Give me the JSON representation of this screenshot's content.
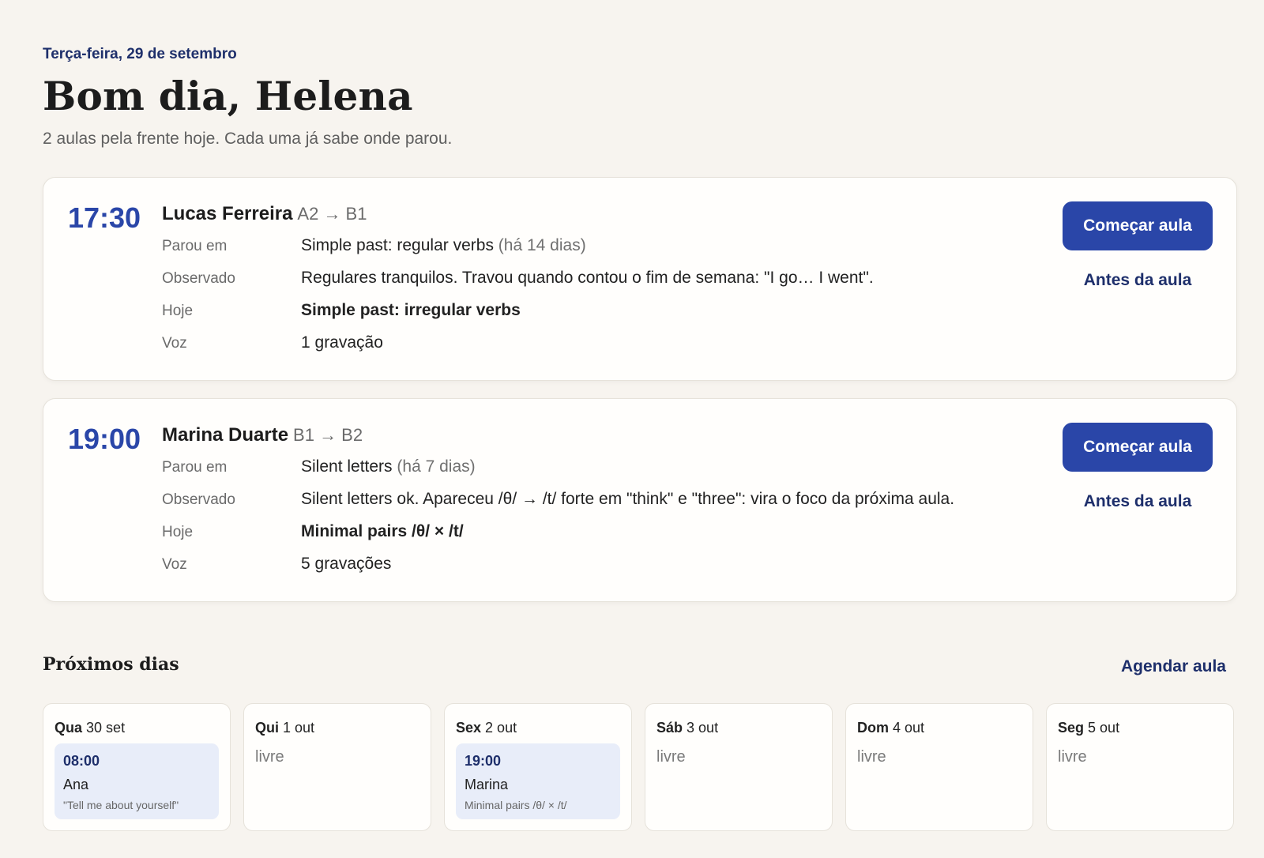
{
  "header": {
    "date": "Terça-feira, 29 de setembro",
    "greeting": "Bom dia, Helena",
    "subtitle": "2 aulas pela frente hoje. Cada uma já sabe onde parou."
  },
  "lessons": [
    {
      "time": "17:30",
      "student": "Lucas Ferreira",
      "level": "A2 → B1",
      "rows": {
        "stopped_label": "Parou em",
        "stopped_value": "Simple past: regular verbs",
        "stopped_ago": "(há 14 dias)",
        "observed_label": "Observado",
        "observed_value": "Regulares tranquilos. Travou quando contou o fim de semana: \"I go… I went\".",
        "today_label": "Hoje",
        "today_value": "Simple past: irregular verbs",
        "voice_label": "Voz",
        "voice_value": "1 gravação"
      },
      "start_label": "Começar aula",
      "before_label": "Antes da aula"
    },
    {
      "time": "19:00",
      "student": "Marina Duarte",
      "level": "B1 → B2",
      "rows": {
        "stopped_label": "Parou em",
        "stopped_value": "Silent letters",
        "stopped_ago": "(há 7 dias)",
        "observed_label": "Observado",
        "observed_value": "Silent letters ok. Apareceu /θ/ → /t/ forte em \"think\" e \"three\": vira o foco da próxima aula.",
        "today_label": "Hoje",
        "today_value": "Minimal pairs /θ/ × /t/",
        "voice_label": "Voz",
        "voice_value": "5 gravações"
      },
      "start_label": "Começar aula",
      "before_label": "Antes da aula"
    }
  ],
  "upcoming": {
    "title": "Próximos dias",
    "schedule_label": "Agendar aula",
    "days": [
      {
        "weekday": "Qua",
        "date": "30 set",
        "event": {
          "time": "08:00",
          "name": "Ana",
          "note": "\"Tell me about yourself\""
        }
      },
      {
        "weekday": "Qui",
        "date": "1 out",
        "free": "livre"
      },
      {
        "weekday": "Sex",
        "date": "2 out",
        "event": {
          "time": "19:00",
          "name": "Marina",
          "note": "Minimal pairs /θ/ × /t/"
        }
      },
      {
        "weekday": "Sáb",
        "date": "3 out",
        "free": "livre"
      },
      {
        "weekday": "Dom",
        "date": "4 out",
        "free": "livre"
      },
      {
        "weekday": "Seg",
        "date": "5 out",
        "free": "livre"
      }
    ]
  },
  "colors": {
    "background": "#f7f4ef",
    "accent": "#2a46a8",
    "link": "#1e2f6b",
    "event_bg": "#e8edf9"
  }
}
